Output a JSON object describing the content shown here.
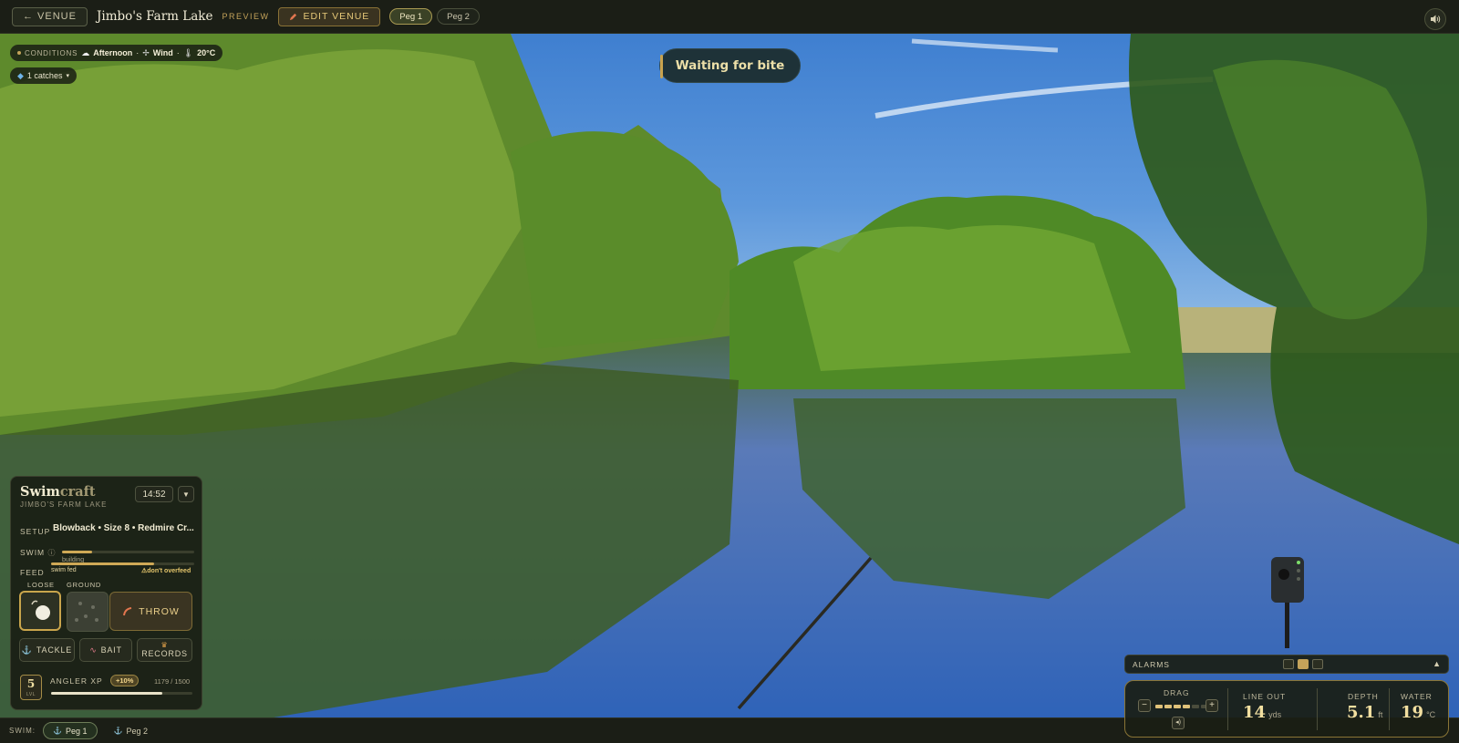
{
  "topbar": {
    "venue_button": "← VENUE",
    "title": "Jimbo's Farm Lake",
    "preview": "PREVIEW",
    "edit_button": "EDIT VENUE",
    "pegs": [
      {
        "label": "Peg 1",
        "active": true
      },
      {
        "label": "Peg 2",
        "active": false
      }
    ],
    "sound_icon": "speaker-icon"
  },
  "conditions": {
    "label": "CONDITIONS",
    "time": "Afternoon",
    "wind": "Wind",
    "temp": "20°C",
    "catches": "1 catches"
  },
  "status": {
    "text": "Waiting for bite"
  },
  "panel": {
    "brand_main": "Swim",
    "brand_accent": "craft",
    "subtitle": "JIMBO'S FARM LAKE",
    "clock": "14:52",
    "collapse": "▼",
    "setup_label": "SETUP",
    "setup_value": "Blowback • Size 8 • Redmire Cr...",
    "swim_label": "SWIM",
    "swim_status": "building",
    "swim_progress": 0.23,
    "feed_label": "FEED",
    "feed_status": "swim fed",
    "feed_warning": "don't overfeed",
    "feed_progress": 0.72,
    "loose_label": "LOOSE",
    "ground_label": "GROUND",
    "throw_label": "THROW",
    "tackle_label": "TACKLE",
    "bait_label": "BAIT",
    "records_label": "RECORDS",
    "level": "5",
    "level_caption": "LVL",
    "xp_label": "ANGLER XP",
    "xp_bonus": "+10%",
    "xp_value": "1179 / 1500",
    "xp_progress": 0.786
  },
  "bottom": {
    "label": "SWIM:",
    "pegs": [
      {
        "label": "Peg 1",
        "active": true
      },
      {
        "label": "Peg 2",
        "active": false
      }
    ]
  },
  "alarms": {
    "label": "ALARMS",
    "caret": "▲"
  },
  "hud": {
    "drag_label": "DRAG",
    "drag_level": 4,
    "drag_max": 6,
    "minus": "−",
    "plus": "+",
    "line_out_label": "LINE OUT",
    "line_out_value": "14",
    "line_out_unit": "yds",
    "depth_label": "DEPTH",
    "depth_value": "5.1",
    "depth_unit": "ft",
    "water_label": "WATER",
    "water_value": "19",
    "water_unit": "°C"
  },
  "colors": {
    "accent": "#c4a35a",
    "panel": "#1b1e16",
    "status_bg": "#1e3238"
  }
}
